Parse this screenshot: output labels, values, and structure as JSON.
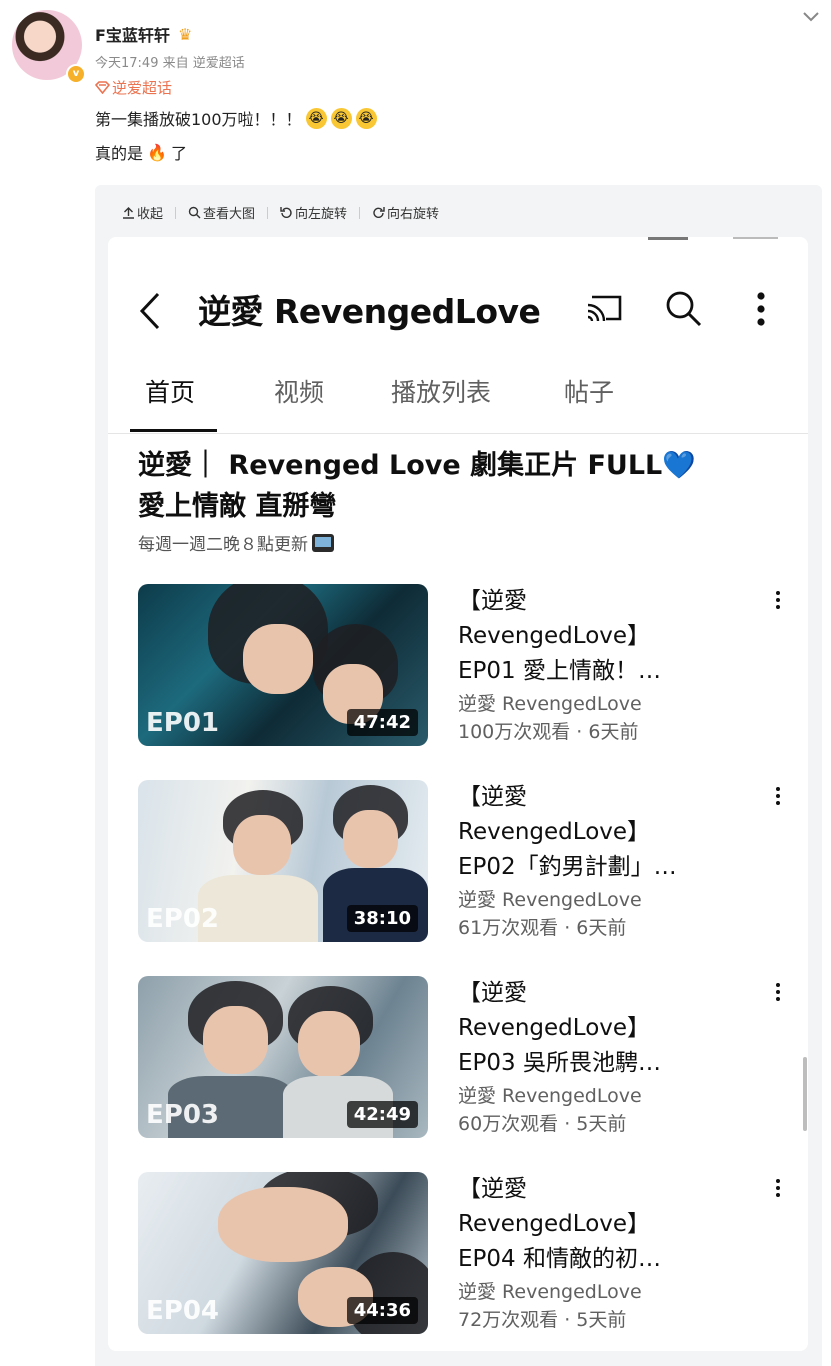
{
  "post": {
    "username": "F宝蓝轩轩",
    "meta": "今天17:49  来自 逆爱超话",
    "topic": "逆爱超话",
    "text1": "第一集播放破100万啦！！！",
    "text2_before": "真的是",
    "text2_after": "了"
  },
  "toolbar": {
    "collapse": "收起",
    "view_large": "查看大图",
    "rotate_left": "向左旋转",
    "rotate_right": "向右旋转"
  },
  "app": {
    "channel_title": "逆愛 RevengedLove",
    "tabs": [
      "首页",
      "视频",
      "播放列表",
      "帖子"
    ]
  },
  "playlist": {
    "title": "逆愛｜ Revenged Love 劇集正片 FULL",
    "title_line2": "愛上情敵 直掰彎",
    "subtitle": "每週一週二晚８點更新"
  },
  "videos": [
    {
      "ep": "EP01",
      "duration": "47:42",
      "title": "【逆愛\nRevengedLove】\nEP01 愛上情敵！…",
      "channel": "逆愛 RevengedLove",
      "stats": "100万次观看 · 6天前"
    },
    {
      "ep": "EP02",
      "duration": "38:10",
      "title": "【逆愛\nRevengedLove】\nEP02「釣男計劃」…",
      "channel": "逆愛 RevengedLove",
      "stats": "61万次观看 · 6天前"
    },
    {
      "ep": "EP03",
      "duration": "42:49",
      "title": "【逆愛\nRevengedLove】\nEP03 吳所畏池騁…",
      "channel": "逆愛 RevengedLove",
      "stats": "60万次观看 · 5天前"
    },
    {
      "ep": "EP04",
      "duration": "44:36",
      "title": "【逆愛\nRevengedLove】\nEP04 和情敵的初…",
      "channel": "逆愛 RevengedLove",
      "stats": "72万次观看 · 5天前"
    }
  ]
}
